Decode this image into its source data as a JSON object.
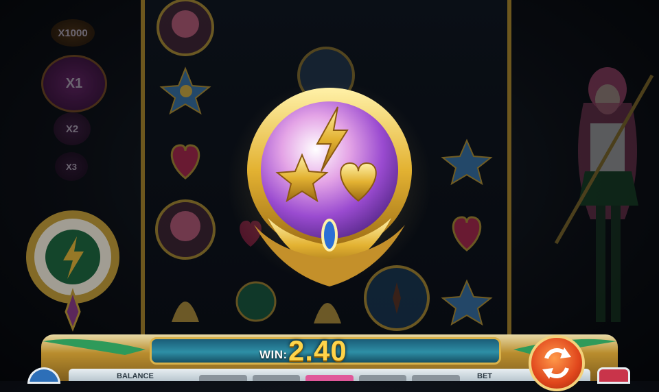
{
  "multipliers": [
    "X1000",
    "X1",
    "X2",
    "X3"
  ],
  "win": {
    "label": "WIN:",
    "value": "2.40"
  },
  "footer": {
    "balance_label": "BALANCE",
    "bet_label": "BET"
  },
  "icons": {
    "hero": "orb-bonus-icon",
    "spin": "spin-icon",
    "menu": "menu-icon",
    "info": "info-icon"
  },
  "colors": {
    "gold": "#d9b24a",
    "win": "#ffd44a",
    "panel": "#2e8fa6",
    "spin": "#e0461c"
  }
}
